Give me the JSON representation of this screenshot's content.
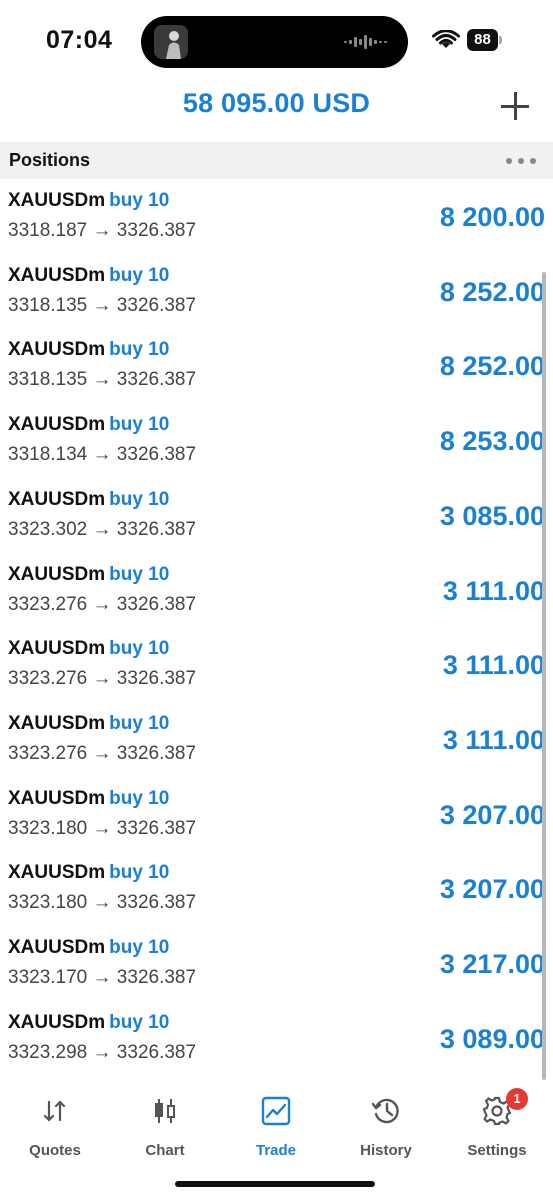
{
  "status_bar": {
    "time": "07:04",
    "battery": "88"
  },
  "header": {
    "balance": "58 095.00 USD"
  },
  "section": {
    "title": "Positions"
  },
  "positions": [
    {
      "symbol": "XAUUSDm",
      "side": "buy 10",
      "prices": "3318.187 → 3326.387",
      "profit": "8 200.00"
    },
    {
      "symbol": "XAUUSDm",
      "side": "buy 10",
      "prices": "3318.135 → 3326.387",
      "profit": "8 252.00"
    },
    {
      "symbol": "XAUUSDm",
      "side": "buy 10",
      "prices": "3318.135 → 3326.387",
      "profit": "8 252.00"
    },
    {
      "symbol": "XAUUSDm",
      "side": "buy 10",
      "prices": "3318.134 → 3326.387",
      "profit": "8 253.00"
    },
    {
      "symbol": "XAUUSDm",
      "side": "buy 10",
      "prices": "3323.302 → 3326.387",
      "profit": "3 085.00"
    },
    {
      "symbol": "XAUUSDm",
      "side": "buy 10",
      "prices": "3323.276 → 3326.387",
      "profit": "3 111.00"
    },
    {
      "symbol": "XAUUSDm",
      "side": "buy 10",
      "prices": "3323.276 → 3326.387",
      "profit": "3 111.00"
    },
    {
      "symbol": "XAUUSDm",
      "side": "buy 10",
      "prices": "3323.276 → 3326.387",
      "profit": "3 111.00"
    },
    {
      "symbol": "XAUUSDm",
      "side": "buy 10",
      "prices": "3323.180 → 3326.387",
      "profit": "3 207.00"
    },
    {
      "symbol": "XAUUSDm",
      "side": "buy 10",
      "prices": "3323.180 → 3326.387",
      "profit": "3 207.00"
    },
    {
      "symbol": "XAUUSDm",
      "side": "buy 10",
      "prices": "3323.170 → 3326.387",
      "profit": "3 217.00"
    },
    {
      "symbol": "XAUUSDm",
      "side": "buy 10",
      "prices": "3323.298 → 3326.387",
      "profit": "3 089.00"
    }
  ],
  "tabs": [
    {
      "label": "Quotes",
      "icon": "quotes-icon",
      "active": false
    },
    {
      "label": "Chart",
      "icon": "chart-icon",
      "active": false
    },
    {
      "label": "Trade",
      "icon": "trade-icon",
      "active": true
    },
    {
      "label": "History",
      "icon": "history-icon",
      "active": false
    },
    {
      "label": "Settings",
      "icon": "settings-icon",
      "active": false,
      "badge": "1"
    }
  ],
  "colors": {
    "accent": "#1a80d4",
    "badge": "#e53935"
  }
}
